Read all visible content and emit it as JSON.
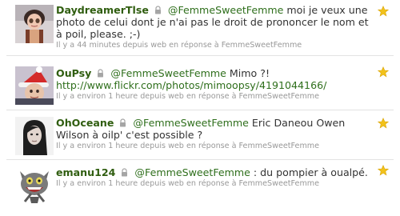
{
  "tweets": [
    {
      "user": "DaydreamerTlse",
      "mention": "@FemmeSweetFemme",
      "text": " moi je veux une photo de celui dont je n'ai pas le droit de prononcer le nom et à poil, please. ;-)",
      "url": "",
      "time": "Il y a 44 minutes",
      "via": "depuis web",
      "reply": "en réponse à FemmeSweetFemme"
    },
    {
      "user": "OuPsy",
      "mention": "@FemmeSweetFemme",
      "text": " Mimo ?! ",
      "url": "http://www.flickr.com/photos/mimoopsy/4191044166/",
      "time": "Il y a environ 1 heure",
      "via": "depuis web",
      "reply": "en réponse à FemmeSweetFemme"
    },
    {
      "user": "OhOceane",
      "mention": "@FemmeSweetFemme",
      "text": " Eric Daneou Owen Wilson à oilp' c'est possible ?",
      "url": "",
      "time": "Il y a environ 1 heure",
      "via": "depuis web",
      "reply": "en réponse à FemmeSweetFemme"
    },
    {
      "user": "emanu124",
      "mention": "@FemmeSweetFemme",
      "text": " : du pompier à oualpé.",
      "url": "",
      "time": "Il y a environ 1 heure",
      "via": "depuis web",
      "reply": "en réponse à FemmeSweetFemme"
    }
  ],
  "colors": {
    "username": "#2f5d0f",
    "link": "#2f6f1c",
    "meta": "#999999",
    "star": "#f2c21b"
  },
  "icons": {
    "protected": "lock-icon",
    "favorite": "star-icon"
  }
}
